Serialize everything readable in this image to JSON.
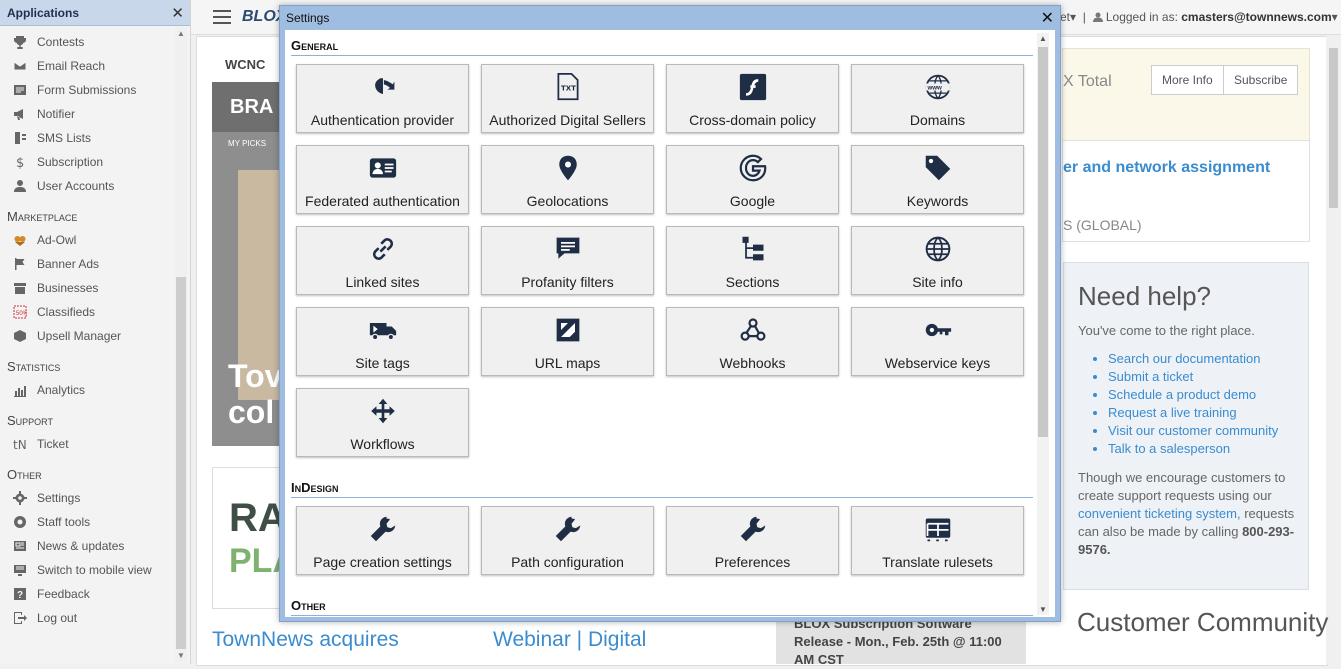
{
  "apps_panel": {
    "title": "Applications",
    "items_top": [
      {
        "label": "Contests",
        "icon": "trophy-icon"
      },
      {
        "label": "Email Reach",
        "icon": "envelope-icon"
      },
      {
        "label": "Form Submissions",
        "icon": "form-icon"
      },
      {
        "label": "Notifier",
        "icon": "megaphone-icon"
      },
      {
        "label": "SMS Lists",
        "icon": "mobile-icon"
      },
      {
        "label": "Subscription",
        "icon": "dollar-icon"
      },
      {
        "label": "User Accounts",
        "icon": "user-icon"
      }
    ],
    "sections": [
      {
        "title": "Marketplace",
        "items": [
          {
            "label": "Ad-Owl",
            "icon": "owl-icon"
          },
          {
            "label": "Banner Ads",
            "icon": "flag-icon"
          },
          {
            "label": "Businesses",
            "icon": "store-icon"
          },
          {
            "label": "Classifieds",
            "icon": "classifieds-icon"
          },
          {
            "label": "Upsell Manager",
            "icon": "cube-icon"
          }
        ]
      },
      {
        "title": "Statistics",
        "items": [
          {
            "label": "Analytics",
            "icon": "bar-chart-icon"
          }
        ]
      },
      {
        "title": "Support",
        "items": [
          {
            "label": "Ticket",
            "icon": "ticket-icon"
          }
        ]
      },
      {
        "title": "Other",
        "items": [
          {
            "label": "Settings",
            "icon": "gear-icon"
          },
          {
            "label": "Staff tools",
            "icon": "life-ring-icon"
          },
          {
            "label": "News & updates",
            "icon": "newspaper-icon"
          },
          {
            "label": "Switch to mobile view",
            "icon": "mobile-switch-icon"
          },
          {
            "label": "Feedback",
            "icon": "question-icon"
          },
          {
            "label": "Log out",
            "icon": "logout-icon"
          }
        ]
      }
    ]
  },
  "topbar": {
    "logo": "BLOX",
    "partial_menu": "et",
    "logged_in_label": "Logged in as:",
    "user": "cmasters@townnews.com"
  },
  "background": {
    "wcnc_logo": "WCNC",
    "image_brand": "BRA",
    "image_mypicks": "MY PICKS",
    "image_big_text": "Tov\ncol",
    "rap_line1": "RA",
    "rap_line2": "PLA",
    "headline_1": "TownNews acquires",
    "headline_2": "Webinar | Digital",
    "blox_total_title": "X Total",
    "more_info_label": "More Info",
    "subscribe_label": "Subscribe",
    "server_title": "er and network assignment",
    "server_global": "S (GLOBAL)",
    "help_title": "Need help?",
    "help_sub": "You've come to the right place.",
    "help_links": [
      "Search our documentation",
      "Submit a ticket",
      "Schedule a product demo",
      "Request a live training",
      "Visit our customer community",
      "Talk to a salesperson"
    ],
    "help_para_1": "Though we encourage customers to create support requests using our",
    "help_para_link": "convenient ticketing system,",
    "help_para_2": "requests can also be made by calling",
    "help_phone": "800-293-9576.",
    "release_text": "BLOX Subscription Software Release - Mon., Feb. 25th @ 11:00 AM CST",
    "community_title": "Customer Community"
  },
  "modal": {
    "title": "Settings",
    "groups": [
      {
        "title": "General",
        "tiles": [
          {
            "label": "Authentication provider",
            "icon": "openid-icon"
          },
          {
            "label": "Authorized Digital Sellers",
            "icon": "txt-file-icon"
          },
          {
            "label": "Cross-domain policy",
            "icon": "flash-icon"
          },
          {
            "label": "Domains",
            "icon": "www-globe-icon"
          },
          {
            "label": "Federated authentication",
            "icon": "id-card-icon"
          },
          {
            "label": "Geolocations",
            "icon": "map-marker-icon"
          },
          {
            "label": "Google",
            "icon": "google-icon"
          },
          {
            "label": "Keywords",
            "icon": "tag-icon"
          },
          {
            "label": "Linked sites",
            "icon": "link-icon"
          },
          {
            "label": "Profanity filters",
            "icon": "comment-icon"
          },
          {
            "label": "Sections",
            "icon": "sitemap-icon"
          },
          {
            "label": "Site info",
            "icon": "globe-icon"
          },
          {
            "label": "Site tags",
            "icon": "shipping-icon"
          },
          {
            "label": "URL maps",
            "icon": "map-icon"
          },
          {
            "label": "Webhooks",
            "icon": "webhook-icon"
          },
          {
            "label": "Webservice keys",
            "icon": "key-icon"
          },
          {
            "label": "Workflows",
            "icon": "arrows-icon"
          }
        ]
      },
      {
        "title": "InDesign",
        "tiles": [
          {
            "label": "Page creation settings",
            "icon": "wrench-icon"
          },
          {
            "label": "Path configuration",
            "icon": "wrench-icon"
          },
          {
            "label": "Preferences",
            "icon": "wrench-icon"
          },
          {
            "label": "Translate rulesets",
            "icon": "table-icon"
          }
        ]
      },
      {
        "title": "Other",
        "tiles": []
      }
    ]
  }
}
